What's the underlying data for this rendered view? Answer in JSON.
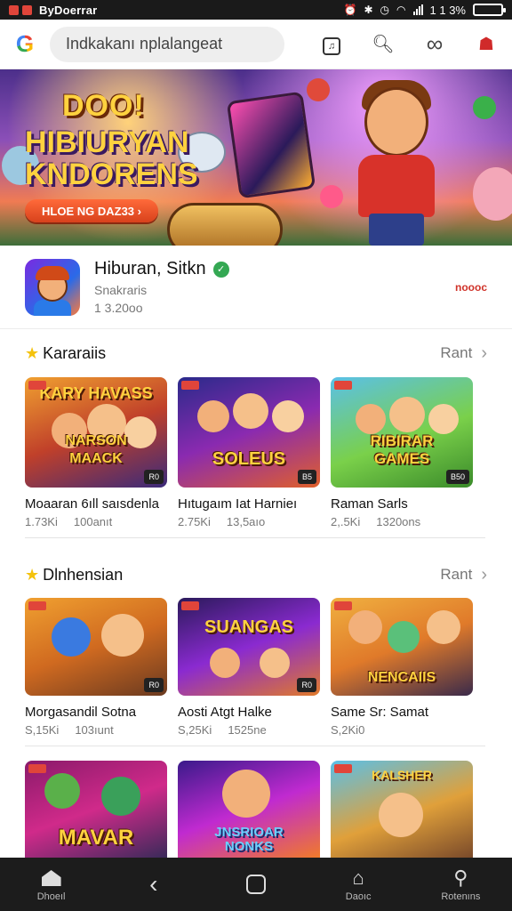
{
  "status_bar": {
    "app_label": "ByDoerrar",
    "battery_text": "1 1 3%",
    "battery_level": 0.85
  },
  "search": {
    "value": "Indkakanı nplalangeat"
  },
  "banner": {
    "title_line1": "DOO!",
    "title_line2": "HIBIURYAN",
    "title_line3": "KNDORENS",
    "button_label": "HLOE NG DAZ33 ›"
  },
  "app": {
    "name": "Hiburan, Sitkn",
    "developer": "Snakraris",
    "size": "1 3.20oo",
    "tag": "noooc"
  },
  "sections": [
    {
      "title": "Kararaiis",
      "more_label": "Rant",
      "cards": [
        {
          "name": "Moaaran 6ıll saısdenla",
          "stat1": "1.73Ki",
          "stat2": "100anıt",
          "img_top": "KARY HAVASS",
          "img_bottom": "NARSON\nMAACK",
          "badge": "R0"
        },
        {
          "name": "Hıtugaım Iat Harnieı",
          "stat1": "2.75Ki",
          "stat2": "13,5aıo",
          "img_top": "",
          "img_bottom": "SOLEUS",
          "badge": "B5"
        },
        {
          "name": "Raman Sarls",
          "stat1": "2,.5Ki",
          "stat2": "1320ons",
          "img_top": "",
          "img_bottom": "RIBIRAR\nGAMES",
          "badge": "B50"
        }
      ]
    },
    {
      "title": "Dlnhensian",
      "more_label": "Rant",
      "cards": [
        {
          "name": "Morgasandil Sotna",
          "stat1": "S,15Ki",
          "stat2": "103ıunt",
          "img_top": "",
          "img_bottom": "",
          "badge": "R0"
        },
        {
          "name": "Aosti Atgt Halke",
          "stat1": "S,25Ki",
          "stat2": "1525ne",
          "img_top": "SUANGAS",
          "img_bottom": "",
          "badge": "R0"
        },
        {
          "name": "Same Sr: Samat",
          "stat1": "S,2Ki0",
          "stat2": "",
          "img_top": "",
          "img_bottom": "NENCAIIS",
          "badge": "R0"
        }
      ]
    },
    {
      "cards": [
        {
          "img_top": "",
          "img_bottom": "MAVAR"
        },
        {
          "img_top": "",
          "img_bottom": "JNSRIOAR\nNONKS"
        },
        {
          "img_top": "KALSHER",
          "img_bottom": ""
        }
      ]
    }
  ],
  "bottom_nav": [
    {
      "label": "Dhoeıl",
      "icon": "home-icon"
    },
    {
      "label": "",
      "icon": "back-icon"
    },
    {
      "label": "",
      "icon": "square-icon"
    },
    {
      "label": "Daoıc",
      "icon": "cast-icon"
    },
    {
      "label": "Rotenıns",
      "icon": "person-icon"
    }
  ],
  "colors": {
    "accent_red": "#d0332a",
    "star_yellow": "#f4c20d",
    "verified_green": "#34a853",
    "nav_bg": "#1c1c1c"
  }
}
